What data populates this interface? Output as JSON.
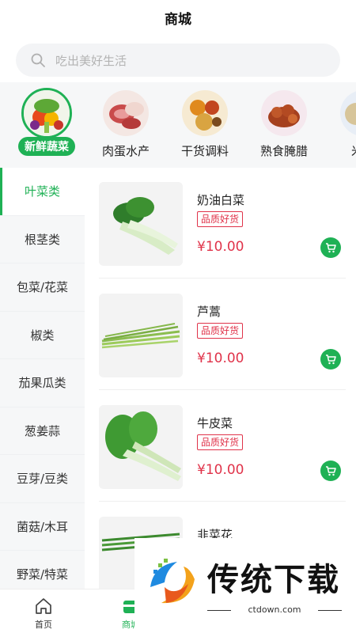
{
  "header": {
    "title": "商城"
  },
  "search": {
    "placeholder": "吃出美好生活",
    "icon": "search-icon"
  },
  "categories": [
    {
      "label": "新鲜蔬菜",
      "active": true
    },
    {
      "label": "肉蛋水产",
      "active": false
    },
    {
      "label": "干货调料",
      "active": false
    },
    {
      "label": "熟食腌腊",
      "active": false
    },
    {
      "label": "米面",
      "active": false
    }
  ],
  "sidebar": {
    "items": [
      {
        "label": "叶菜类",
        "active": true
      },
      {
        "label": "根茎类"
      },
      {
        "label": "包菜/花菜"
      },
      {
        "label": "椒类"
      },
      {
        "label": "茄果瓜类"
      },
      {
        "label": "葱姜蒜"
      },
      {
        "label": "豆芽/豆类"
      },
      {
        "label": "菌菇/木耳"
      },
      {
        "label": "野菜/特菜"
      }
    ]
  },
  "products": [
    {
      "name": "奶油白菜",
      "tag": "品质好货",
      "price": "¥10.00"
    },
    {
      "name": "芦蒿",
      "tag": "品质好货",
      "price": "¥10.00"
    },
    {
      "name": "牛皮菜",
      "tag": "品质好货",
      "price": "¥10.00"
    },
    {
      "name": "韭菜花"
    }
  ],
  "tabbar": {
    "items": [
      {
        "label": "首页",
        "icon": "home-icon"
      },
      {
        "label": "商城",
        "icon": "shop-icon",
        "active": true
      }
    ]
  },
  "watermark": {
    "text": "传统下载",
    "sub": "ctdown.com"
  },
  "colors": {
    "accent": "#1fb155",
    "price": "#e0334a",
    "background": "#f6f7f8"
  }
}
